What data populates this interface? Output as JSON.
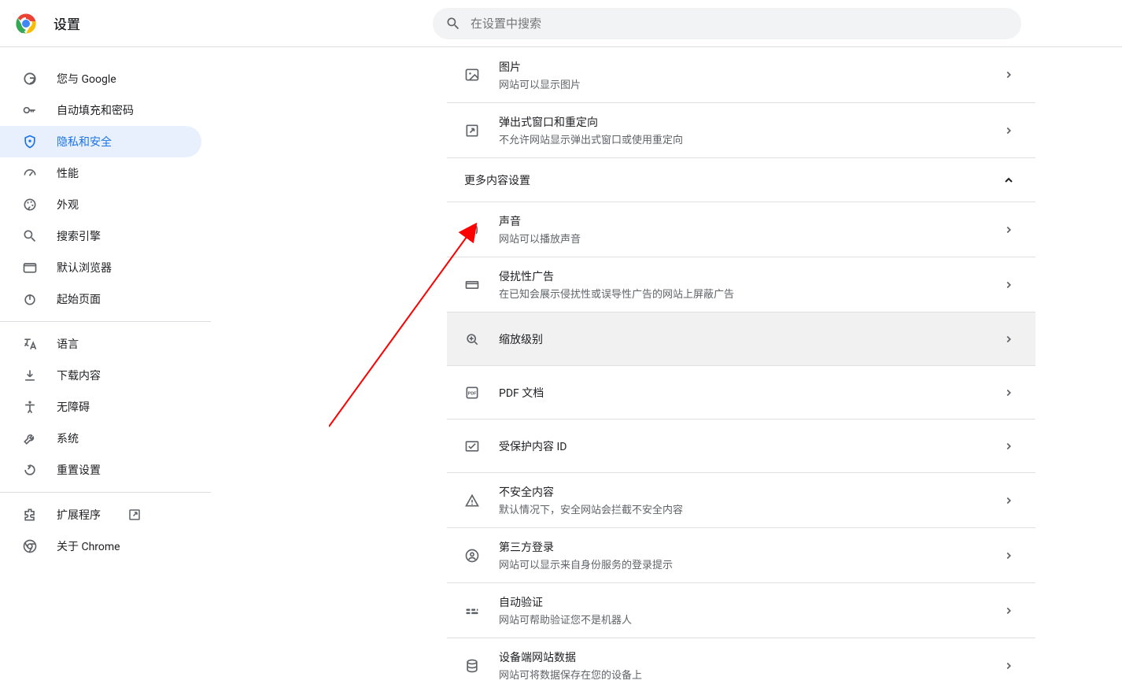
{
  "header": {
    "title": "设置",
    "search_placeholder": "在设置中搜索"
  },
  "sidebar": {
    "items": [
      {
        "id": "you-and-google",
        "label": "您与 Google"
      },
      {
        "id": "autofill",
        "label": "自动填充和密码"
      },
      {
        "id": "privacy",
        "label": "隐私和安全",
        "active": true
      },
      {
        "id": "performance",
        "label": "性能"
      },
      {
        "id": "appearance",
        "label": "外观"
      },
      {
        "id": "search-engine",
        "label": "搜索引擎"
      },
      {
        "id": "default-browser",
        "label": "默认浏览器"
      },
      {
        "id": "on-startup",
        "label": "起始页面"
      }
    ],
    "items2": [
      {
        "id": "languages",
        "label": "语言"
      },
      {
        "id": "downloads",
        "label": "下载内容"
      },
      {
        "id": "accessibility",
        "label": "无障碍"
      },
      {
        "id": "system",
        "label": "系统"
      },
      {
        "id": "reset",
        "label": "重置设置"
      }
    ],
    "items3": [
      {
        "id": "extensions",
        "label": "扩展程序",
        "external": true
      },
      {
        "id": "about",
        "label": "关于 Chrome"
      }
    ]
  },
  "content": {
    "top": [
      {
        "id": "images",
        "title": "图片",
        "sub": "网站可以显示图片"
      },
      {
        "id": "popups",
        "title": "弹出式窗口和重定向",
        "sub": "不允许网站显示弹出式窗口或使用重定向"
      }
    ],
    "section_title": "更多内容设置",
    "more": [
      {
        "id": "sound",
        "title": "声音",
        "sub": "网站可以播放声音"
      },
      {
        "id": "ads",
        "title": "侵扰性广告",
        "sub": "在已知会展示侵扰性或误导性广告的网站上屏蔽广告"
      },
      {
        "id": "zoom",
        "title": "缩放级别",
        "single": true,
        "hover": true
      },
      {
        "id": "pdf",
        "title": "PDF 文档",
        "single": true
      },
      {
        "id": "protected",
        "title": "受保护内容 ID",
        "single": true
      },
      {
        "id": "insecure",
        "title": "不安全内容",
        "sub": "默认情况下，安全网站会拦截不安全内容"
      },
      {
        "id": "thirdparty",
        "title": "第三方登录",
        "sub": "网站可以显示来自身份服务的登录提示"
      },
      {
        "id": "autoverify",
        "title": "自动验证",
        "sub": "网站可帮助验证您不是机器人"
      },
      {
        "id": "devicedata",
        "title": "设备端网站数据",
        "sub": "网站可将数据保存在您的设备上"
      }
    ]
  }
}
